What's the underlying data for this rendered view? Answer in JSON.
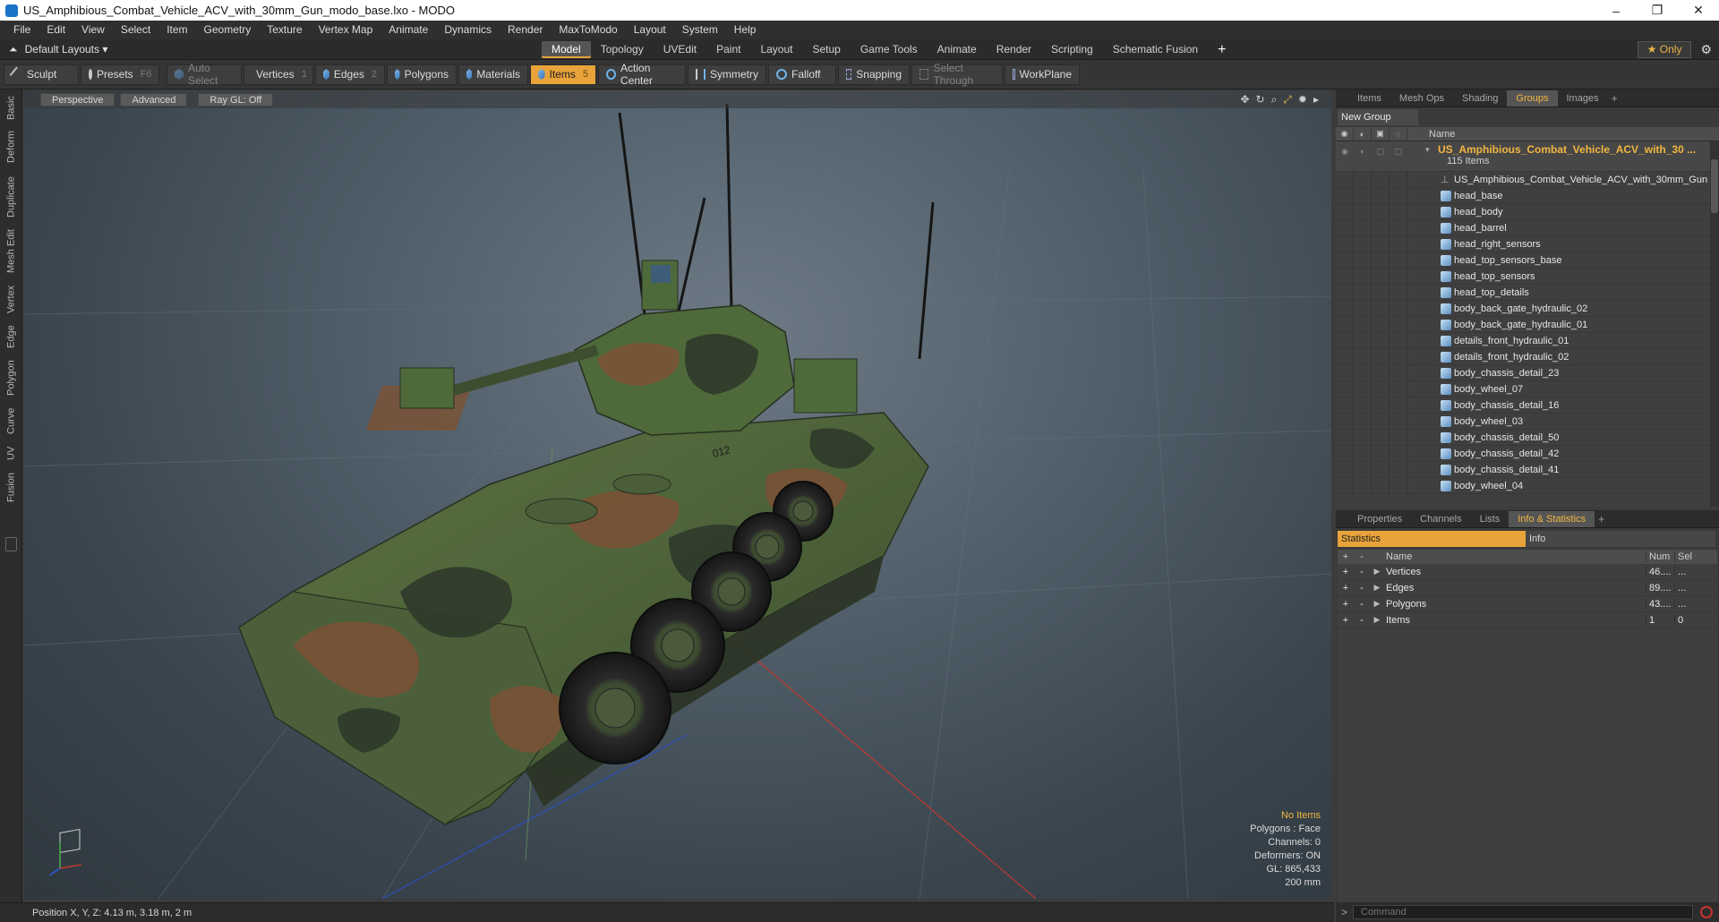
{
  "window": {
    "title": "US_Amphibious_Combat_Vehicle_ACV_with_30mm_Gun_modo_base.lxo - MODO",
    "minimize": "–",
    "maximize": "❐",
    "close": "✕"
  },
  "menu": [
    "File",
    "Edit",
    "View",
    "Select",
    "Item",
    "Geometry",
    "Texture",
    "Vertex Map",
    "Animate",
    "Dynamics",
    "Render",
    "MaxToModo",
    "Layout",
    "System",
    "Help"
  ],
  "layoutbar": {
    "layout_name": "Default Layouts ▾",
    "tabs": [
      "Model",
      "Topology",
      "UVEdit",
      "Paint",
      "Layout",
      "Setup",
      "Game Tools",
      "Animate",
      "Render",
      "Scripting",
      "Schematic Fusion"
    ],
    "active_tab": "Model",
    "add": "+",
    "only_label": "★  Only",
    "gear": "⚙"
  },
  "toolbar": {
    "sculpt": "Sculpt",
    "presets": "Presets",
    "presets_key": "F6",
    "auto_select": "Auto Select",
    "vertices": "Vertices",
    "vertices_key": "1",
    "edges": "Edges",
    "edges_key": "2",
    "polygons": "Polygons",
    "materials": "Materials",
    "items": "Items",
    "items_key": "5",
    "action_center": "Action Center",
    "symmetry": "Symmetry",
    "falloff": "Falloff",
    "snapping": "Snapping",
    "select_through": "Select Through",
    "workplane": "WorkPlane"
  },
  "left_tabs": [
    "Basic",
    "Deform",
    "Duplicate",
    "Mesh Edit",
    "Vertex",
    "Edge",
    "Polygon",
    "Curve",
    "UV",
    "Fusion"
  ],
  "viewport": {
    "perspective": "Perspective",
    "advanced": "Advanced",
    "raygl": "Ray GL: Off",
    "stats": {
      "no_items": "No Items",
      "polygons": "Polygons : Face",
      "channels": "Channels: 0",
      "deformers": "Deformers: ON",
      "gl": "GL: 865,433",
      "scale": "200 mm"
    }
  },
  "statusbar": {
    "position": "Position X, Y, Z:   4.13 m, 3.18 m, 2 m"
  },
  "groups_panel": {
    "tabs": [
      "Items",
      "Mesh Ops",
      "Shading",
      "Groups",
      "Images"
    ],
    "active_tab": "Groups",
    "new_group": "New Group",
    "column_name": "Name",
    "group_name": "US_Amphibious_Combat_Vehicle_ACV_with_30 ...",
    "group_count": "115 Items",
    "items": [
      "US_Amphibious_Combat_Vehicle_ACV_with_30mm_Gun",
      "head_base",
      "head_body",
      "head_barrel",
      "head_right_sensors",
      "head_top_sensors_base",
      "head_top_sensors",
      "head_top_details",
      "body_back_gate_hydraulic_02",
      "body_back_gate_hydraulic_01",
      "details_front_hydraulic_01",
      "details_front_hydraulic_02",
      "body_chassis_detail_23",
      "body_wheel_07",
      "body_chassis_detail_16",
      "body_wheel_03",
      "body_chassis_detail_50",
      "body_chassis_detail_42",
      "body_chassis_detail_41",
      "body_wheel_04"
    ]
  },
  "info_panel": {
    "tabs": [
      "Properties",
      "Channels",
      "Lists",
      "Info & Statistics"
    ],
    "active_tab": "Info & Statistics",
    "subtabs": [
      "Statistics",
      "Info"
    ],
    "columns": {
      "name": "Name",
      "num": "Num",
      "sel": "Sel"
    },
    "rows": [
      {
        "name": "Vertices",
        "num": "46....",
        "sel": "..."
      },
      {
        "name": "Edges",
        "num": "89....",
        "sel": "..."
      },
      {
        "name": "Polygons",
        "num": "43....",
        "sel": "..."
      },
      {
        "name": "Items",
        "num": "1",
        "sel": "0"
      }
    ]
  },
  "command": {
    "placeholder": "Command"
  },
  "colors": {
    "accent": "#e8a33a",
    "group_text": "#f2b640",
    "camo_green": "#4f6a3a",
    "camo_brown": "#7a5236",
    "camo_dark": "#2f3a2a"
  }
}
